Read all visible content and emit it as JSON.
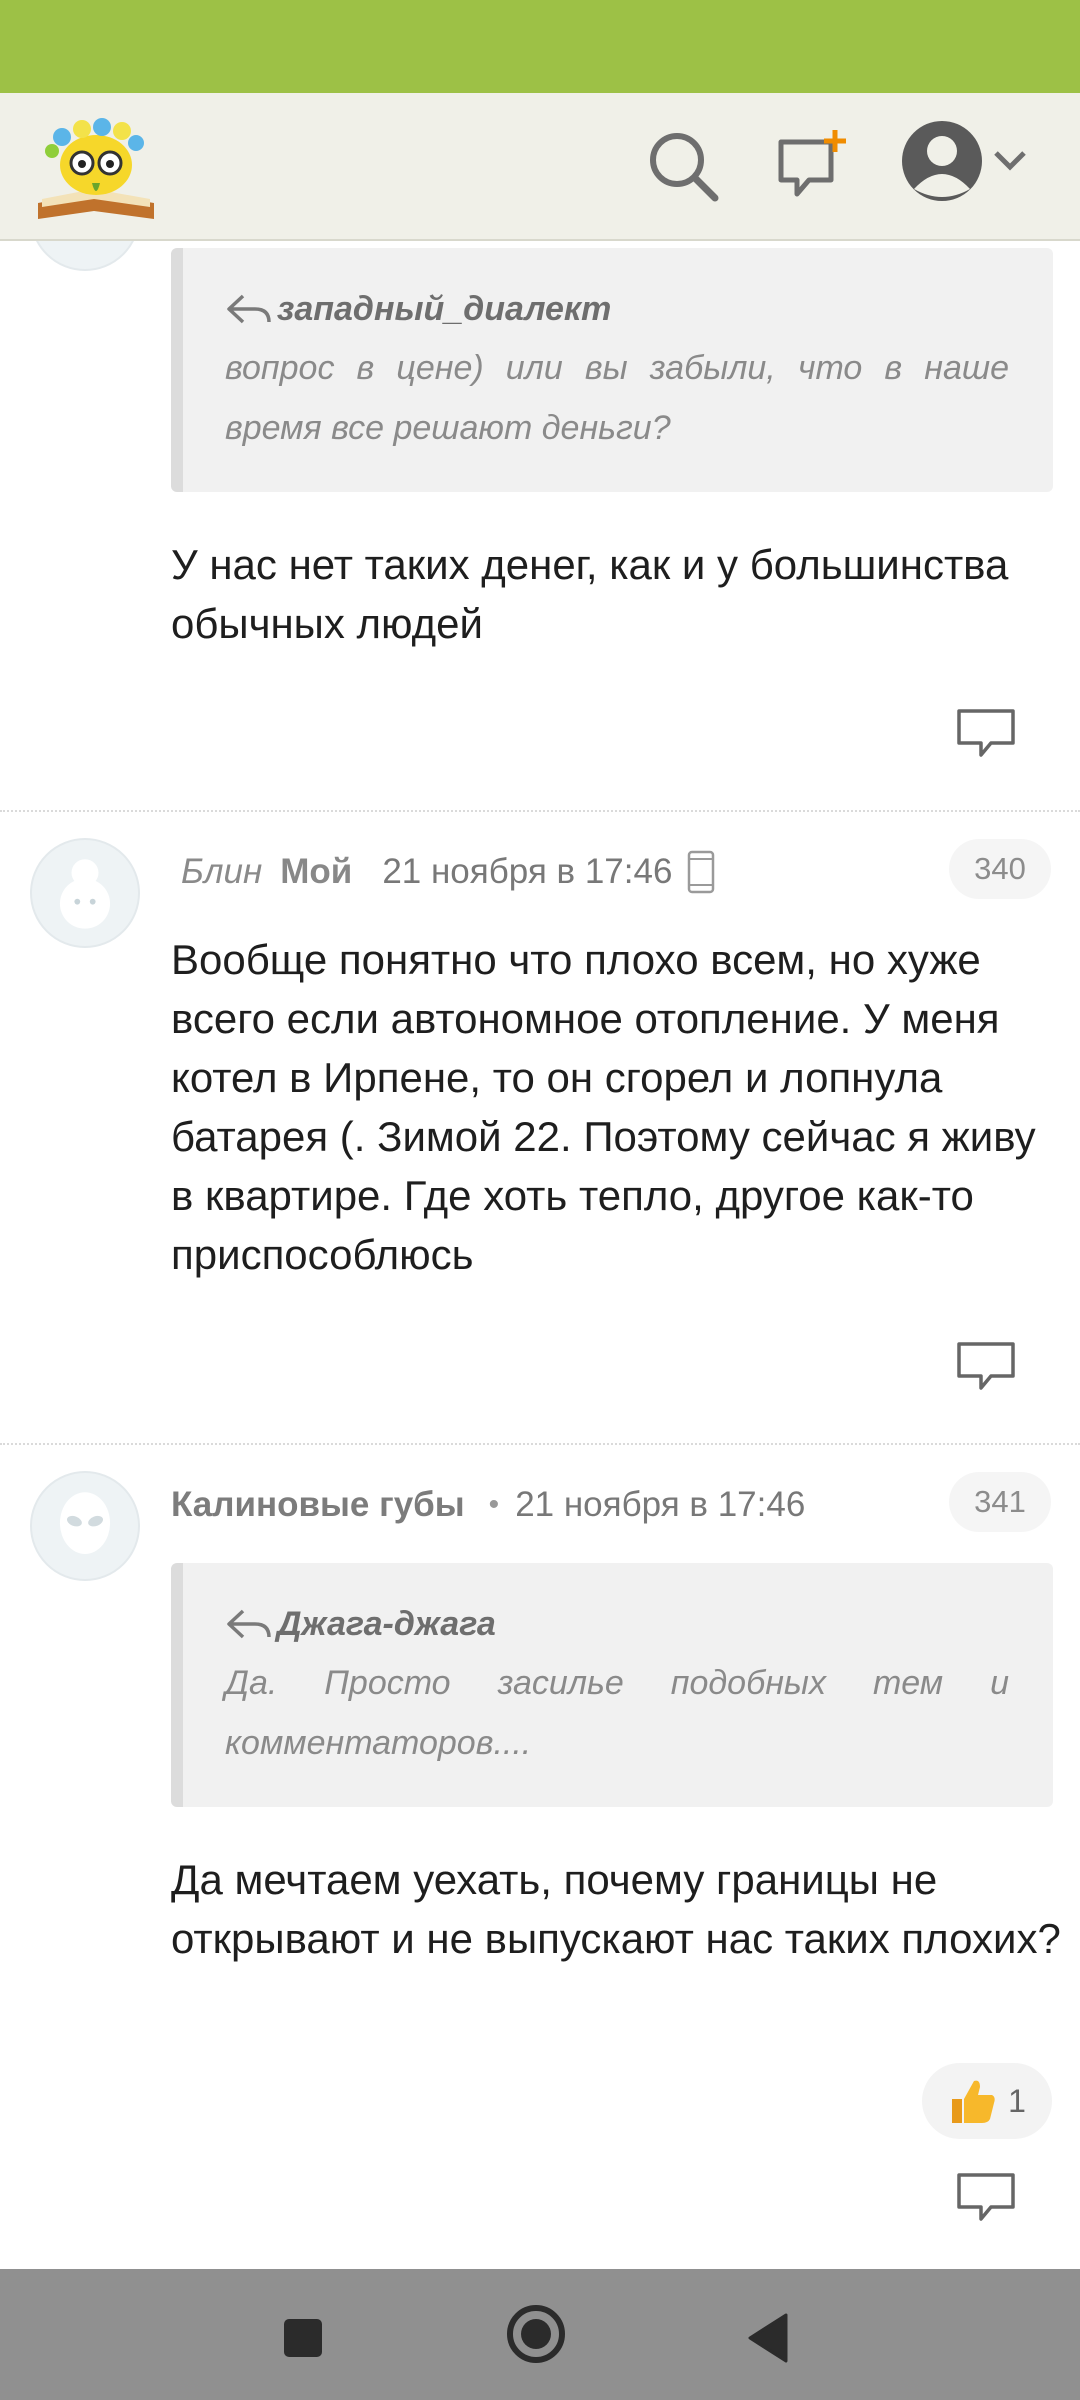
{
  "icons": {
    "logo": "site-logo-emoji-with-glasses-and-book",
    "search": "search-icon",
    "compose": "new-message-icon",
    "profile": "user-avatar-icon",
    "dropdown": "chevron-down-icon",
    "reply": "comment-reply-icon",
    "quote_arrow": "quote-reply-arrow-icon",
    "device": "mobile-phone-icon",
    "like": "thumbs-up-icon"
  },
  "colors": {
    "status_bar": "#9dc146",
    "header_bg": "#f0f0e8",
    "nav_bar": "#909090"
  },
  "comments": [
    {
      "quote_author": "западный_диалект",
      "quote_text": "вопрос в цене) или вы забыли, что в наше время все решают деньги?",
      "text": "У нас нет таких денег, как и у большинства обычных людей"
    },
    {
      "author_italic": "Блин",
      "author_bold": "Мой",
      "date": "21 ноября в 17:46",
      "number": "340",
      "text": "Вообще понятно что плохо всем, но хуже всего если автономное отопление. У меня котел в Ирпене, то он сгорел и лопнула батарея (. Зимой 22. Поэтому сейчас я живу в квартире. Где хоть тепло, другое как-то приспособлюсь"
    },
    {
      "author": "Калиновые губы",
      "separator": "•",
      "date": "21 ноября в 17:46",
      "number": "341",
      "quote_author": "Джага-джага",
      "quote_text": "Да. Просто засилье подобных тем и комментаторов....",
      "text": "Да мечтаем уехать, почему границы не открывают и не выпускают нас таких плохих?",
      "likes": "1"
    }
  ]
}
